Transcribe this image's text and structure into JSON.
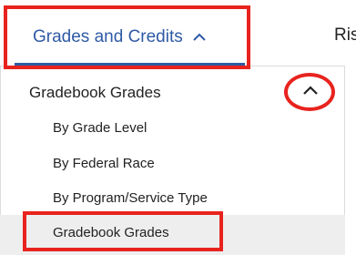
{
  "nav": {
    "active_tab_label": "Grades and Credits",
    "next_tab_label": "Ris"
  },
  "menu": {
    "section_label": "Gradebook Grades",
    "items": [
      {
        "label": "By Grade Level"
      },
      {
        "label": "By Federal Race"
      },
      {
        "label": "By Program/Service Type"
      },
      {
        "label": "Gradebook Grades",
        "selected": true
      }
    ]
  },
  "colors": {
    "accent": "#2f5aa6",
    "annotation": "#e8231e",
    "selected_row": "#eeeeee"
  },
  "icons": [
    "chevron-up-icon"
  ]
}
